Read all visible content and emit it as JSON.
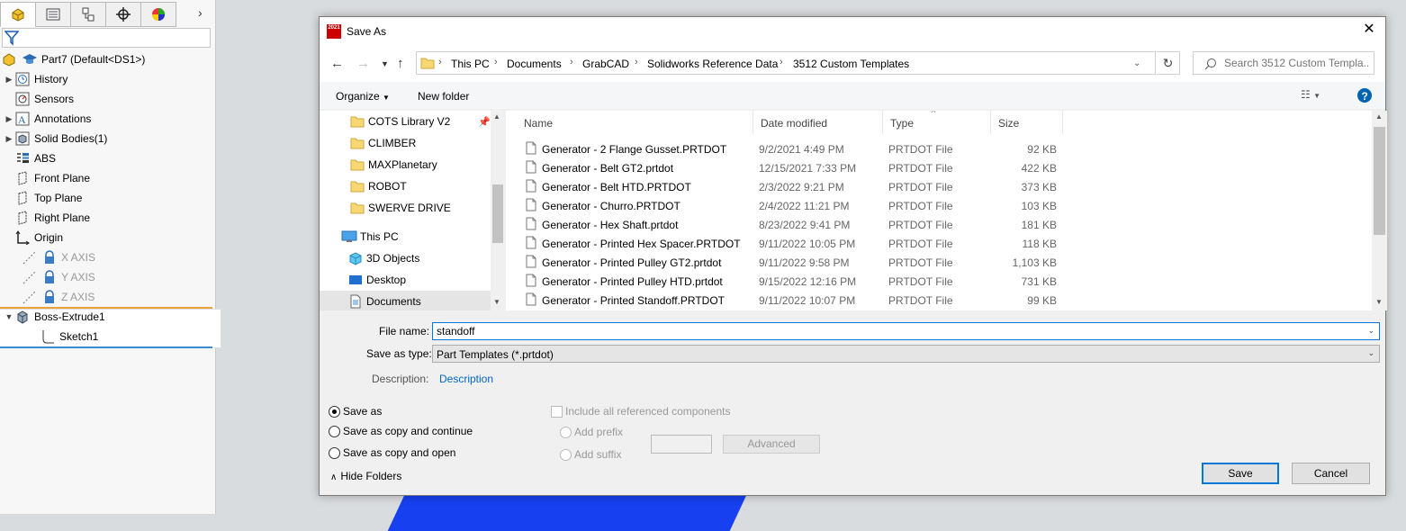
{
  "tree": {
    "tabs": [
      "feature-manager",
      "property-manager",
      "configuration-manager",
      "dimxpert-manager",
      "display-manager"
    ],
    "part": "Part7  (Default<DS1>)",
    "nodes": [
      {
        "label": "History",
        "icon": "history-icon"
      },
      {
        "label": "Sensors",
        "icon": "sensors-icon"
      },
      {
        "label": "Annotations",
        "icon": "annotations-icon"
      },
      {
        "label": "Solid Bodies(1)",
        "icon": "solid-bodies-icon"
      },
      {
        "label": "ABS",
        "icon": "material-icon"
      },
      {
        "label": "Front Plane",
        "icon": "plane-icon"
      },
      {
        "label": "Top Plane",
        "icon": "plane-icon"
      },
      {
        "label": "Right Plane",
        "icon": "plane-icon"
      },
      {
        "label": "Origin",
        "icon": "origin-icon"
      },
      {
        "label": "X AXIS",
        "icon": "axis-icon"
      },
      {
        "label": "Y AXIS",
        "icon": "axis-icon"
      },
      {
        "label": "Z AXIS",
        "icon": "axis-icon"
      },
      {
        "label": "Boss-Extrude1",
        "icon": "extrude-icon"
      },
      {
        "label": "Sketch1",
        "icon": "sketch-icon"
      }
    ]
  },
  "dialog": {
    "title": "Save As",
    "logo_text": "2021",
    "breadcrumb": [
      "This PC",
      "Documents",
      "GrabCAD",
      "Solidworks Reference Data",
      "3512 Custom Templates"
    ],
    "search_placeholder": "Search 3512 Custom Templa...",
    "toolbar": {
      "organize": "Organize",
      "new_folder": "New folder"
    },
    "nav": [
      {
        "label": "COTS Library V2",
        "icon": "folder-icon",
        "pinned": true
      },
      {
        "label": "CLIMBER",
        "icon": "folder-icon"
      },
      {
        "label": "MAXPlanetary",
        "icon": "folder-icon"
      },
      {
        "label": "ROBOT",
        "icon": "folder-icon"
      },
      {
        "label": "SWERVE DRIVE",
        "icon": "folder-icon"
      },
      {
        "label": "This PC",
        "icon": "computer-icon"
      },
      {
        "label": "3D Objects",
        "icon": "cube-icon"
      },
      {
        "label": "Desktop",
        "icon": "desktop-icon"
      },
      {
        "label": "Documents",
        "icon": "documents-icon"
      }
    ],
    "columns": {
      "name": "Name",
      "date": "Date modified",
      "type": "Type",
      "size": "Size"
    },
    "files": [
      {
        "name": "Generator - 2 Flange Gusset.PRTDOT",
        "date": "9/2/2021 4:49 PM",
        "type": "PRTDOT File",
        "size": "92 KB"
      },
      {
        "name": "Generator - Belt GT2.prtdot",
        "date": "12/15/2021 7:33 PM",
        "type": "PRTDOT File",
        "size": "422 KB"
      },
      {
        "name": "Generator - Belt HTD.PRTDOT",
        "date": "2/3/2022 9:21 PM",
        "type": "PRTDOT File",
        "size": "373 KB"
      },
      {
        "name": "Generator - Churro.PRTDOT",
        "date": "2/4/2022 11:21 PM",
        "type": "PRTDOT File",
        "size": "103 KB"
      },
      {
        "name": "Generator - Hex Shaft.prtdot",
        "date": "8/23/2022 9:41 PM",
        "type": "PRTDOT File",
        "size": "181 KB"
      },
      {
        "name": "Generator - Printed Hex Spacer.PRTDOT",
        "date": "9/11/2022 10:05 PM",
        "type": "PRTDOT File",
        "size": "118 KB"
      },
      {
        "name": "Generator - Printed Pulley GT2.prtdot",
        "date": "9/11/2022 9:58 PM",
        "type": "PRTDOT File",
        "size": "1,103 KB"
      },
      {
        "name": "Generator - Printed Pulley HTD.prtdot",
        "date": "9/15/2022 12:16 PM",
        "type": "PRTDOT File",
        "size": "731 KB"
      },
      {
        "name": "Generator - Printed Standoff.PRTDOT",
        "date": "9/11/2022 10:07 PM",
        "type": "PRTDOT File",
        "size": "99 KB"
      }
    ],
    "file_name_label": "File name:",
    "file_name_value": "standoff",
    "save_type_label": "Save as type:",
    "save_type_value": "Part Templates (*.prtdot)",
    "description_label": "Description:",
    "description_value": "Description",
    "options": {
      "save_as": "Save as",
      "save_copy_continue": "Save as copy and continue",
      "save_copy_open": "Save as copy and open",
      "include_refs": "Include all referenced components",
      "add_prefix": "Add prefix",
      "add_suffix": "Add suffix",
      "advanced": "Advanced"
    },
    "hide_folders": "Hide Folders",
    "save_button": "Save",
    "cancel_button": "Cancel"
  },
  "colors": {
    "accent": "#0078d7",
    "folder": "#f8d775",
    "link": "#0066cc"
  }
}
